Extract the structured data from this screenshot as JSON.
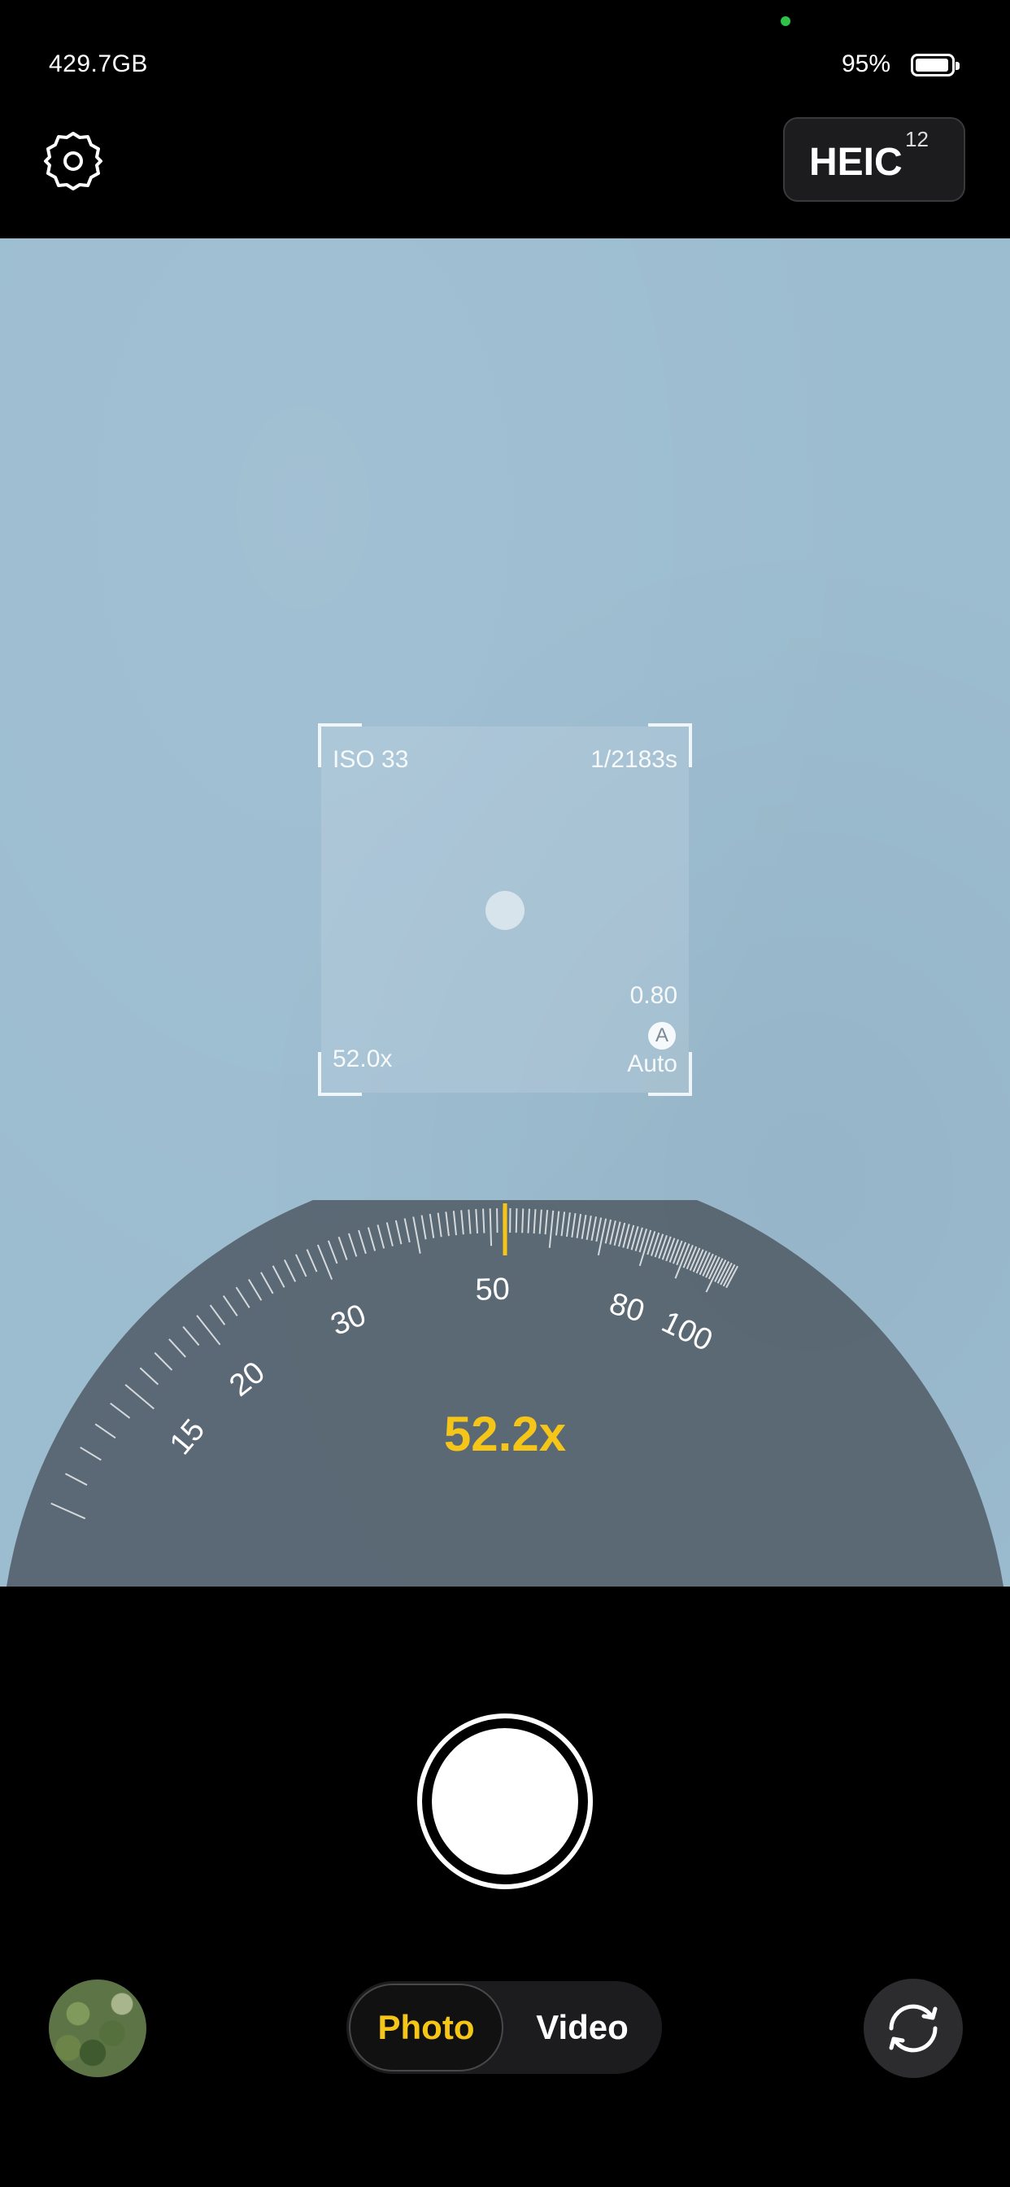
{
  "status_bar": {
    "storage": "429.7GB",
    "battery_percent": "95%",
    "battery_level": 0.95
  },
  "top_bar": {
    "format_label": "HEIC",
    "format_count": "12"
  },
  "focus_box": {
    "iso": "ISO 33",
    "shutter_speed": "1/2183s",
    "zoom": "52.0x",
    "exposure_value": "0.80",
    "auto_badge": "A",
    "white_balance": "Auto"
  },
  "zoom_dial": {
    "readout": "52.2x",
    "current_zoom": 52.2,
    "tick_labels": [
      "15",
      "20",
      "30",
      "50",
      "80",
      "100"
    ]
  },
  "bottom_bar": {
    "modes": {
      "photo": "Photo",
      "video": "Video"
    },
    "selected_mode": "Photo"
  },
  "colors": {
    "accent": "#f5c518",
    "viewfinder": "#9cbcd0",
    "dial": "#55626d"
  },
  "icons": {
    "settings": "gear-icon",
    "flip_camera": "camera-flip-icon"
  }
}
